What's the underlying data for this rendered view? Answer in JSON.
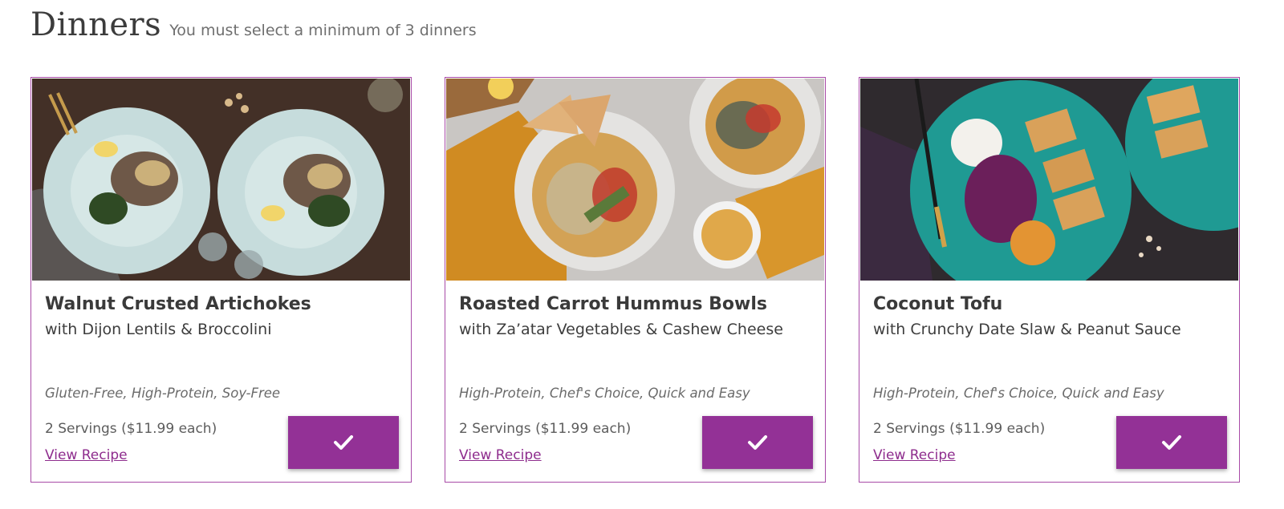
{
  "header": {
    "title": "Dinners",
    "subtitle": "You must select a minimum of 3 dinners"
  },
  "colors": {
    "accent": "#933196",
    "card_border": "#a84aa7",
    "link": "#8e2c8d"
  },
  "meals": [
    {
      "name": "Walnut Crusted Artichokes",
      "subtitle": "with Dijon Lentils & Broccolini",
      "tags": "Gluten-Free, High-Protein, Soy-Free",
      "price": "2 Servings ($11.99 each)",
      "link": "View Recipe",
      "selected_icon": "checkmark-icon"
    },
    {
      "name": "Roasted Carrot Hummus Bowls",
      "subtitle": "with Za’atar Vegetables & Cashew Cheese",
      "tags": "High-Protein, Chef's Choice, Quick and Easy",
      "price": "2 Servings ($11.99 each)",
      "link": "View Recipe",
      "selected_icon": "checkmark-icon"
    },
    {
      "name": "Coconut Tofu",
      "subtitle": "with Crunchy Date Slaw & Peanut Sauce",
      "tags": "High-Protein, Chef's Choice, Quick and Easy",
      "price": "2 Servings ($11.99 each)",
      "link": "View Recipe",
      "selected_icon": "checkmark-icon"
    }
  ]
}
